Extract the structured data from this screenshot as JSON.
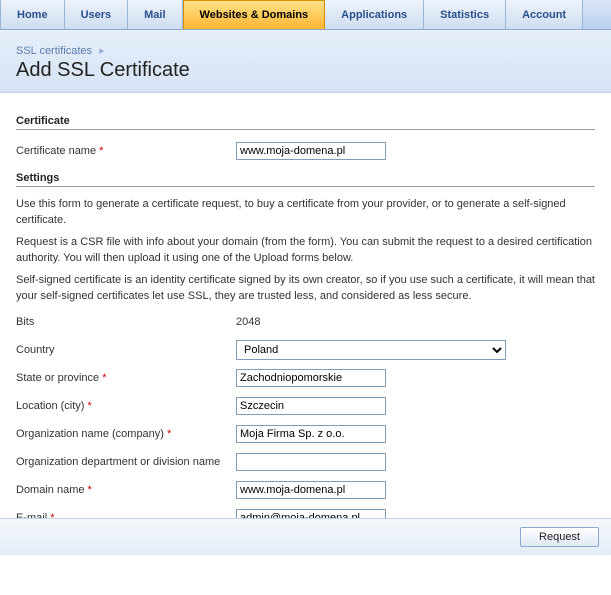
{
  "nav": {
    "tabs": [
      {
        "label": "Home"
      },
      {
        "label": "Users"
      },
      {
        "label": "Mail"
      },
      {
        "label": "Websites & Domains"
      },
      {
        "label": "Applications"
      },
      {
        "label": "Statistics"
      },
      {
        "label": "Account"
      }
    ],
    "activeIndex": 3
  },
  "breadcrumb": {
    "item": "SSL certificates",
    "sep": "▸"
  },
  "page": {
    "title": "Add SSL Certificate"
  },
  "sections": {
    "certificate": "Certificate",
    "settings": "Settings"
  },
  "fields": {
    "cert_name": {
      "label": "Certificate name",
      "required": true,
      "value": "www.moja-domena.pl"
    },
    "bits": {
      "label": "Bits",
      "value": "2048"
    },
    "country": {
      "label": "Country",
      "value": "Poland"
    },
    "state": {
      "label": "State or province",
      "required": true,
      "value": "Zachodniopomorskie"
    },
    "city": {
      "label": "Location (city)",
      "required": true,
      "value": "Szczecin"
    },
    "org": {
      "label": "Organization name (company)",
      "required": true,
      "value": "Moja Firma Sp. z o.o."
    },
    "dept": {
      "label": "Organization department or division name",
      "required": false,
      "value": ""
    },
    "domain": {
      "label": "Domain name",
      "required": true,
      "value": "www.moja-domena.pl"
    },
    "email": {
      "label": "E-mail",
      "required": true,
      "value": "admin@moja-domena.pl"
    }
  },
  "help": {
    "p1": "Use this form to generate a certificate request, to buy a certificate from your provider, or to generate a self-signed certificate.",
    "p2": "Request is a CSR file with info about your domain (from the form). You can submit the request to a desired certification authority. You will then upload it using one of the Upload forms below.",
    "p3": "Self-signed certificate is an identity certificate signed by its own creator, so if you use such a certificate, it will mean that your self-signed certificates let use SSL, they are trusted less, and considered as less secure."
  },
  "buttons": {
    "request": "Request"
  },
  "requiredMark": "*"
}
